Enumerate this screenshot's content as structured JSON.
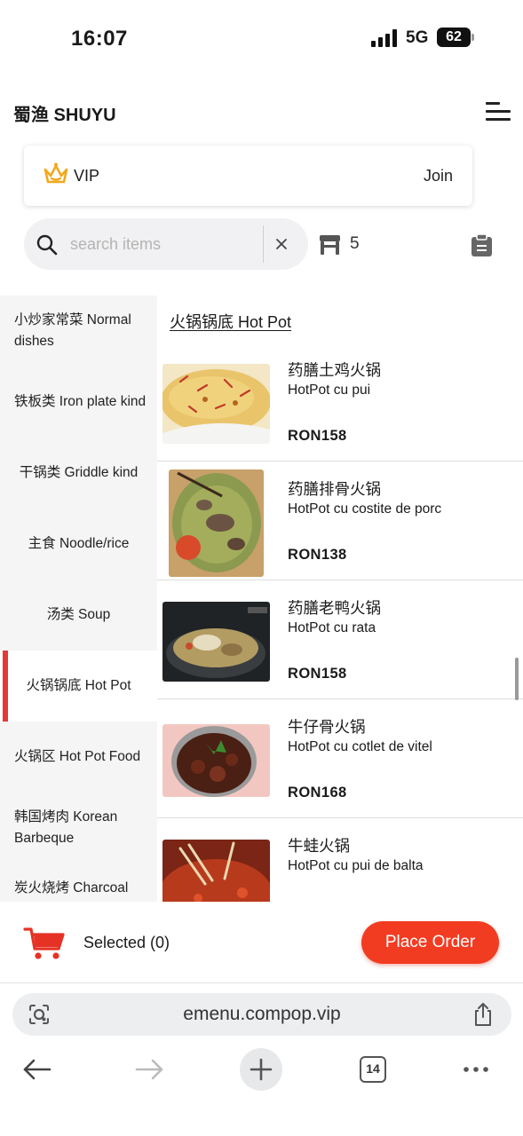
{
  "status_bar": {
    "time": "16:07",
    "network": "5G",
    "battery": "62"
  },
  "header": {
    "brand": "蜀渔 SHUYU"
  },
  "vip": {
    "label": "VIP",
    "join": "Join"
  },
  "search": {
    "placeholder": "search items",
    "table_count": "5"
  },
  "categories": [
    {
      "label": "小炒家常菜 Normal dishes",
      "active": false
    },
    {
      "label": "铁板类 Iron plate kind",
      "active": false
    },
    {
      "label": "干锅类 Griddle kind",
      "active": false
    },
    {
      "label": "主食 Noodle/rice",
      "active": false
    },
    {
      "label": "汤类 Soup",
      "active": false
    },
    {
      "label": "火锅锅底 Hot Pot",
      "active": true
    },
    {
      "label": "火锅区 Hot Pot Food",
      "active": false
    },
    {
      "label": "韩国烤肉 Korean Barbeque",
      "active": false
    },
    {
      "label": "炭火烧烤 Charcoal",
      "active": false
    }
  ],
  "section": {
    "title": "火锅锅底 Hot Pot"
  },
  "items": [
    {
      "name_cn": "药膳土鸡火锅",
      "name_ro": "HotPot cu pui",
      "price": "RON158"
    },
    {
      "name_cn": "药膳排骨火锅",
      "name_ro": "HotPot cu costite de porc",
      "price": "RON138"
    },
    {
      "name_cn": "药膳老鸭火锅",
      "name_ro": "HotPot cu rata",
      "price": "RON158"
    },
    {
      "name_cn": "牛仔骨火锅",
      "name_ro": "HotPot cu cotlet de vitel",
      "price": "RON168"
    },
    {
      "name_cn": "牛蛙火锅",
      "name_ro": "HotPot cu pui de balta",
      "price": ""
    }
  ],
  "order_bar": {
    "selected": "Selected (0)",
    "place_order": "Place Order"
  },
  "browser": {
    "url": "emenu.compop.vip",
    "tab_count": "14"
  },
  "colors": {
    "accent": "#f23c22",
    "active_marker": "#e53935",
    "crown": "#f2a81d"
  }
}
